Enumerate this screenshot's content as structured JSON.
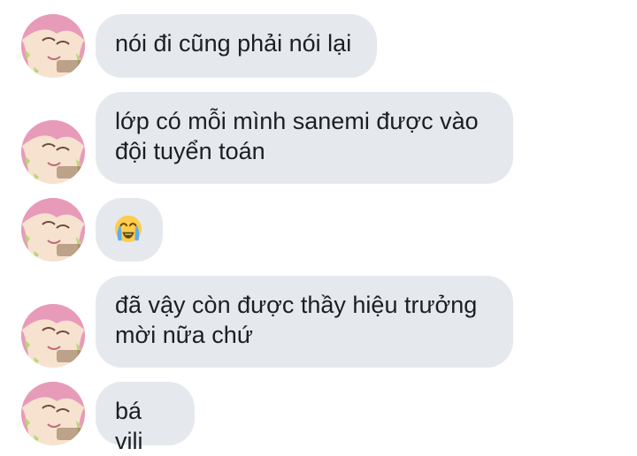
{
  "messages": [
    {
      "text": "nói đi cũng phải nói lại",
      "has_avatar": true
    },
    {
      "text": "lớp có mỗi mình sanemi được vào đội tuyển toán",
      "has_avatar": true
    },
    {
      "emoji": "loudly-crying-face-emoji",
      "text": "",
      "has_avatar": true
    },
    {
      "text": "đã vậy còn được thầy hiệu trưởng mời nữa chứ",
      "has_avatar": true
    },
    {
      "text": "bá vili",
      "has_avatar": true
    }
  ],
  "colors": {
    "bubble": "#e5e9ee",
    "text": "#1c1e21",
    "background": "#ffffff",
    "avatar_hair": "#e89ab9",
    "avatar_hair_tips": "#b9d77a",
    "avatar_skin": "#f6e2cf"
  }
}
